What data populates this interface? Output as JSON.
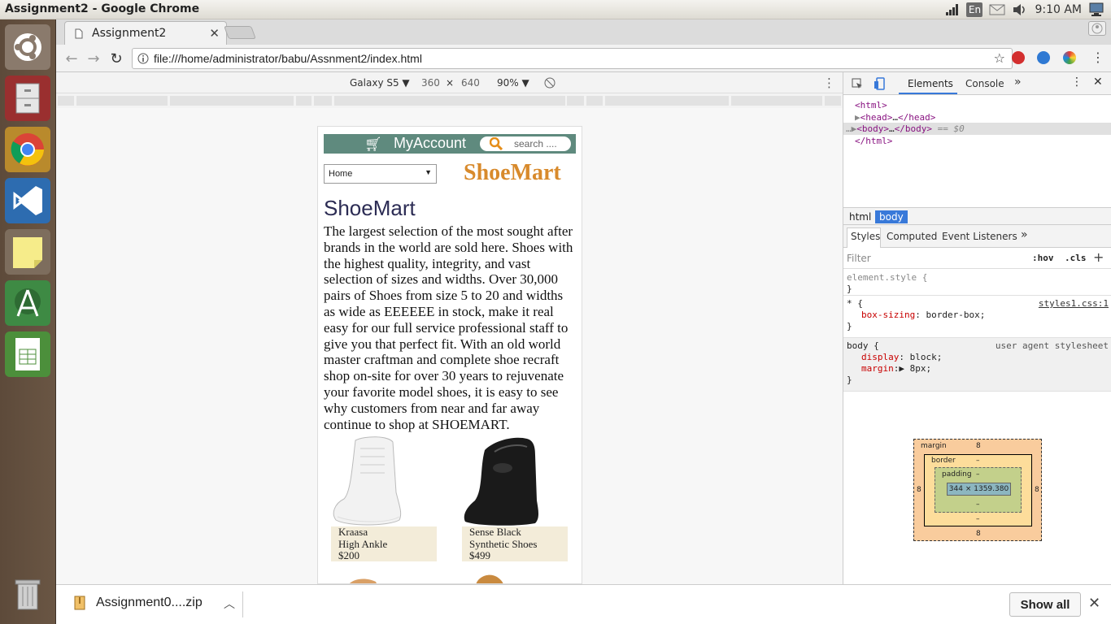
{
  "window": {
    "title": "Assignment2 - Google Chrome"
  },
  "tray": {
    "keyboard": "En",
    "clock": "9:10 AM"
  },
  "launcher": {
    "apps": [
      "ubuntu-dash-icon",
      "files-icon",
      "chrome-icon",
      "vscode-icon",
      "sticky-notes-icon",
      "android-studio-icon",
      "spreadsheet-icon",
      "trash-icon"
    ]
  },
  "browser": {
    "tab_title": "Assignment2",
    "url": "file:///home/administrator/babu/Assnment2/index.html"
  },
  "device_toolbar": {
    "device": "Galaxy S5",
    "width": "360",
    "times": "×",
    "height": "640",
    "zoom": "90%"
  },
  "page": {
    "account": "MyAccount",
    "search_placeholder": "search ....",
    "select_value": "Home",
    "brand": "ShoeMart",
    "heading": "ShoeMart",
    "paragraph": "The largest selection of the most sought after brands in the world are sold here. Shoes with the highest quality, integrity, and vast selection of sizes and widths. Over 30,000 pairs of Shoes from size 5 to 20 and widths as wide as EEEEEE in stock, make it real easy for our full service professional staff to give you that perfect fit. With an old world master craftman and complete shoe recraft shop on-site for over 30 years to rejuvenate your favorite model shoes, it is easy to see why customers from near and far away continue to shop at SHOEMART.",
    "products": [
      {
        "line1": "Kraasa",
        "line2": "High Ankle",
        "price": "$200"
      },
      {
        "line1": "Sense Black",
        "line2": "Synthetic Shoes",
        "price": "$499"
      }
    ]
  },
  "download_bar": {
    "file": "Assignment0....zip",
    "show_all": "Show all"
  },
  "devtools": {
    "tabs": [
      "Elements",
      "Console"
    ],
    "dom": {
      "l1": "<html>",
      "l2a": "<head>",
      "l2b": "…",
      "l2c": "</head>",
      "l3a": "<body>",
      "l3b": "…",
      "l3c": "</body>",
      "l3d": "== $0",
      "l4": "</html>"
    },
    "crumbs": [
      "html",
      "body"
    ],
    "subtabs": [
      "Styles",
      "Computed",
      "Event Listeners"
    ],
    "filter_placeholder": "Filter",
    "hov": ":hov",
    "cls": ".cls",
    "rules": {
      "r1_sel": "element.style {",
      "close": "}",
      "r2_sel": "* {",
      "r2_src": "styles1.css:1",
      "r2_prop": "box-sizing",
      "r2_val": "border-box;",
      "r3_sel": "body {",
      "r3_src": "user agent stylesheet",
      "r3_p1": "display",
      "r3_v1": "block;",
      "r3_p2": "margin",
      "r3_v2": "8px;"
    },
    "box_model": {
      "margin_label": "margin",
      "margin": "8",
      "border_label": "border",
      "border": "–",
      "padding_label": "padding",
      "padding": "–",
      "content": "344 × 1359.380"
    }
  },
  "colors": {
    "header_green": "#5f8a7e",
    "brand_orange": "#d88a2c",
    "heading_navy": "#2c2c54",
    "caption_bg": "#f3ecd9",
    "devtools_blue": "#3879d9"
  }
}
